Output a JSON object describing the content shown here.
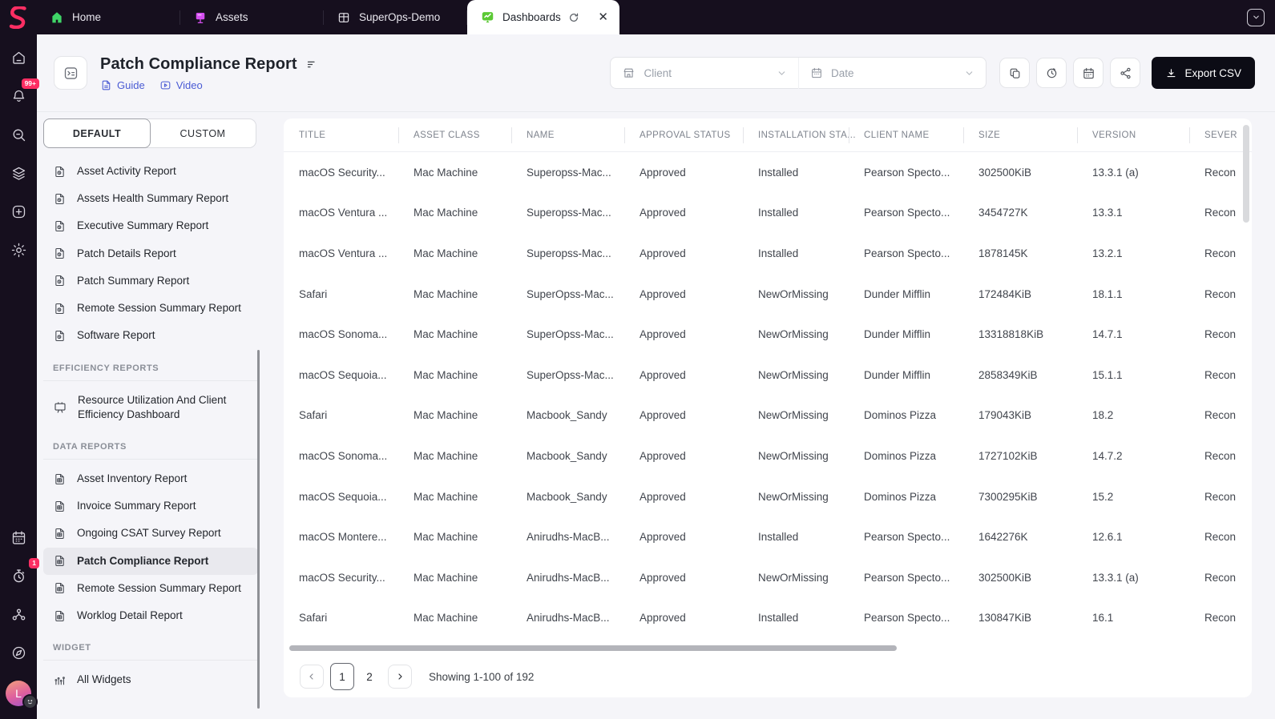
{
  "topbar": {
    "tabs": [
      {
        "label": "Home",
        "icon": "home-tab"
      },
      {
        "label": "Assets",
        "icon": "assets-tab"
      },
      {
        "label": "SuperOps-Demo",
        "icon": "window-grid"
      }
    ],
    "active_tab": {
      "label": "Dashboards",
      "icon": "dashboards-tab"
    }
  },
  "rail": {
    "notification_badge": "99+",
    "timer_badge": "1",
    "avatar_initial": "L"
  },
  "header": {
    "title": "Patch Compliance Report",
    "guide_label": "Guide",
    "video_label": "Video"
  },
  "filters": {
    "client_placeholder": "Client",
    "date_placeholder": "Date"
  },
  "toolbar": {
    "export_label": "Export CSV"
  },
  "sidebar": {
    "tabs": [
      {
        "label": "DEFAULT",
        "active": true
      },
      {
        "label": "CUSTOM",
        "active": false
      }
    ],
    "default_reports": [
      "Asset Activity Report",
      "Assets Health Summary Report",
      "Executive Summary Report",
      "Patch Details Report",
      "Patch Summary Report",
      "Remote Session Summary Report",
      "Software Report"
    ],
    "sections": [
      {
        "title": "EFFICIENCY REPORTS",
        "items": [
          {
            "label": "Resource Utilization And Client Efficiency Dashboard",
            "icon": "board",
            "selected": false
          }
        ]
      },
      {
        "title": "DATA REPORTS",
        "items": [
          {
            "label": "Asset Inventory Report",
            "icon": "grid",
            "selected": false
          },
          {
            "label": "Invoice Summary Report",
            "icon": "grid",
            "selected": false
          },
          {
            "label": "Ongoing CSAT Survey Report",
            "icon": "grid",
            "selected": false
          },
          {
            "label": "Patch Compliance Report",
            "icon": "grid",
            "selected": true
          },
          {
            "label": "Remote Session Summary Report",
            "icon": "grid",
            "selected": false
          },
          {
            "label": "Worklog Detail Report",
            "icon": "grid",
            "selected": false
          }
        ]
      },
      {
        "title": "WIDGET",
        "items": [
          {
            "label": "All Widgets",
            "icon": "chart",
            "selected": false
          }
        ]
      }
    ]
  },
  "table": {
    "columns": [
      "TITLE",
      "ASSET CLASS",
      "NAME",
      "APPROVAL STATUS",
      "INSTALLATION STA...",
      "CLIENT NAME",
      "SIZE",
      "VERSION",
      "SEVER"
    ],
    "rows": [
      [
        "macOS Security...",
        "Mac Machine",
        "Superopss-Mac...",
        "Approved",
        "Installed",
        "Pearson Specto...",
        "302500KiB",
        "13.3.1 (a)",
        "Recon"
      ],
      [
        "macOS Ventura ...",
        "Mac Machine",
        "Superopss-Mac...",
        "Approved",
        "Installed",
        "Pearson Specto...",
        "3454727K",
        "13.3.1",
        "Recon"
      ],
      [
        "macOS Ventura ...",
        "Mac Machine",
        "Superopss-Mac...",
        "Approved",
        "Installed",
        "Pearson Specto...",
        "1878145K",
        "13.2.1",
        "Recon"
      ],
      [
        "Safari",
        "Mac Machine",
        "SuperOpss-Mac...",
        "Approved",
        "NewOrMissing",
        "Dunder Mifflin",
        "172484KiB",
        "18.1.1",
        "Recon"
      ],
      [
        "macOS Sonoma...",
        "Mac Machine",
        "SuperOpss-Mac...",
        "Approved",
        "NewOrMissing",
        "Dunder Mifflin",
        "13318818KiB",
        "14.7.1",
        "Recon"
      ],
      [
        "macOS Sequoia...",
        "Mac Machine",
        "SuperOpss-Mac...",
        "Approved",
        "NewOrMissing",
        "Dunder Mifflin",
        "2858349KiB",
        "15.1.1",
        "Recon"
      ],
      [
        "Safari",
        "Mac Machine",
        "Macbook_Sandy",
        "Approved",
        "NewOrMissing",
        "Dominos Pizza",
        "179043KiB",
        "18.2",
        "Recon"
      ],
      [
        "macOS Sonoma...",
        "Mac Machine",
        "Macbook_Sandy",
        "Approved",
        "NewOrMissing",
        "Dominos Pizza",
        "1727102KiB",
        "14.7.2",
        "Recon"
      ],
      [
        "macOS Sequoia...",
        "Mac Machine",
        "Macbook_Sandy",
        "Approved",
        "NewOrMissing",
        "Dominos Pizza",
        "7300295KiB",
        "15.2",
        "Recon"
      ],
      [
        "macOS Montere...",
        "Mac Machine",
        "Anirudhs-MacB...",
        "Approved",
        "Installed",
        "Pearson Specto...",
        "1642276K",
        "12.6.1",
        "Recon"
      ],
      [
        "macOS Security...",
        "Mac Machine",
        "Anirudhs-MacB...",
        "Approved",
        "NewOrMissing",
        "Pearson Specto...",
        "302500KiB",
        "13.3.1 (a)",
        "Recon"
      ],
      [
        "Safari",
        "Mac Machine",
        "Anirudhs-MacB...",
        "Approved",
        "Installed",
        "Pearson Specto...",
        "130847KiB",
        "16.1",
        "Recon"
      ]
    ]
  },
  "pagination": {
    "pages": [
      "1",
      "2"
    ],
    "current": "1",
    "summary": "Showing 1-100 of 192"
  },
  "colors": {
    "accent_pink": "#fd2e63",
    "topbar_bg": "#160f1e",
    "export_bg": "#0c0c15",
    "link_blue": "#4a5bd4",
    "tab_icon_green": "#5bc934",
    "selected_item_bg": "#e9e9ee"
  }
}
